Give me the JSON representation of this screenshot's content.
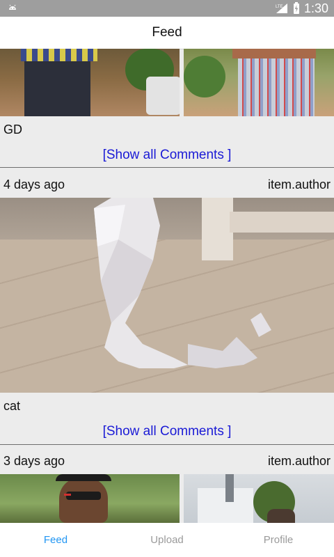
{
  "status_bar": {
    "time": "1:30",
    "network": "LTE",
    "icons": [
      "android-icon",
      "signal-icon",
      "battery-icon"
    ]
  },
  "app_bar": {
    "title": "Feed"
  },
  "feed": {
    "posts": [
      {
        "caption": "GD",
        "show_comments_label": "[Show all Comments ]"
      },
      {
        "time_ago": "4 days ago",
        "author": "item.author",
        "caption": "cat",
        "show_comments_label": "[Show all Comments ]"
      },
      {
        "time_ago": "3 days ago",
        "author": "item.author"
      }
    ]
  },
  "bottom_nav": {
    "tabs": [
      {
        "label": "Feed",
        "active": true
      },
      {
        "label": "Upload",
        "active": false
      },
      {
        "label": "Profile",
        "active": false
      }
    ]
  },
  "colors": {
    "accent": "#2196f3",
    "link": "#1a1ad6",
    "status_bar": "#9e9e9e",
    "background": "#ececec"
  }
}
